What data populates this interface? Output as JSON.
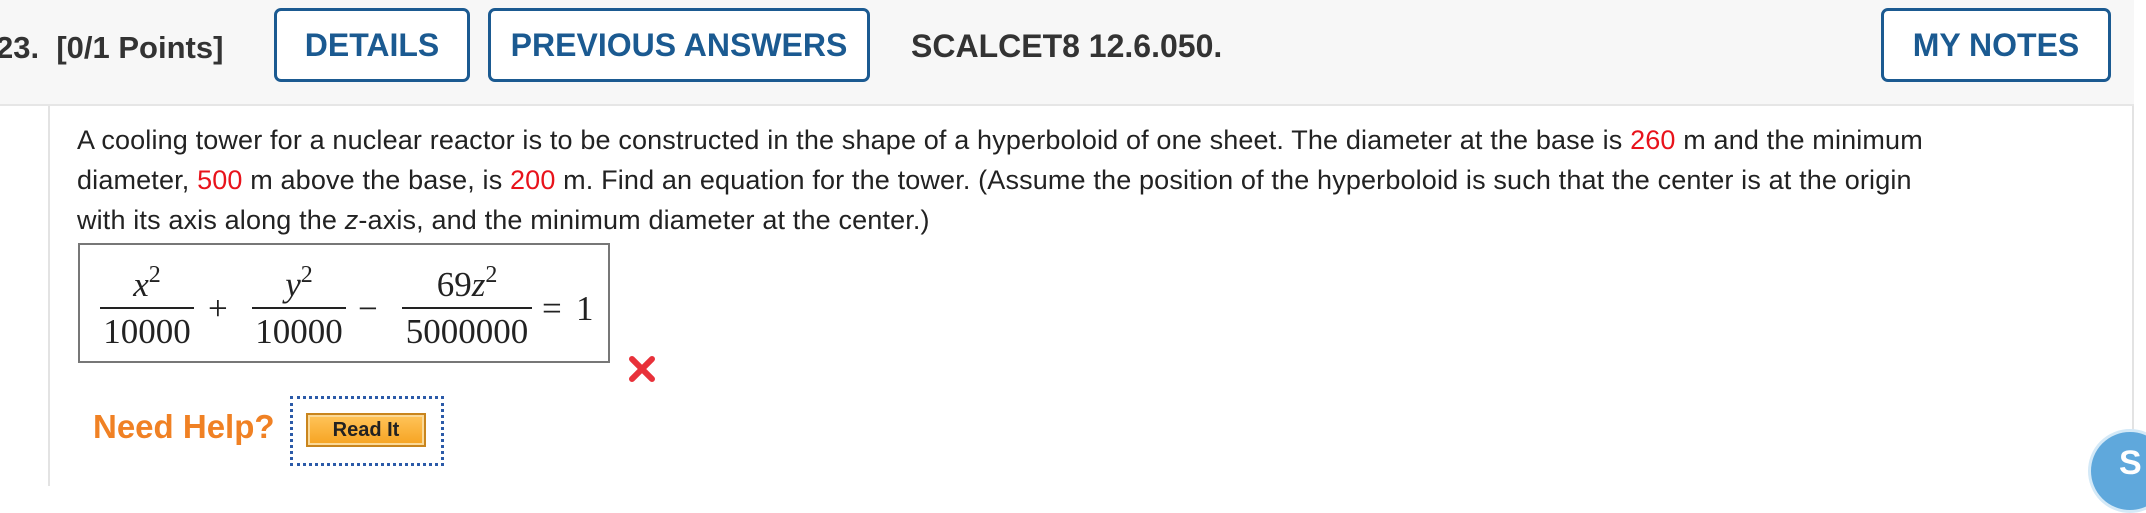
{
  "header": {
    "question_number": "23.",
    "points": "[0/1 Points]",
    "details_label": "DETAILS",
    "previous_answers_label": "PREVIOUS ANSWERS",
    "question_code": "SCALCET8 12.6.050.",
    "my_notes_label": "MY NOTES"
  },
  "problem": {
    "part1": "A cooling tower for a nuclear reactor is to be constructed in the shape of a hyperboloid of one sheet. The diameter at the base is ",
    "base_diameter": "260",
    "part2": " m and the minimum",
    "part3": "diameter, ",
    "height_above_base": "500",
    "part4": " m above the base, is ",
    "min_diameter": "200",
    "part5": " m. Find an equation for the tower. (Assume the position of the hyperboloid is such that the center is at the origin",
    "part6": "with its axis along the ",
    "axis_var": "z",
    "part7": "-axis, and the minimum diameter at the center.)"
  },
  "answer": {
    "term1_var": "x",
    "term1_exp": "2",
    "term1_den": "10000",
    "op1": "+",
    "term2_var": "y",
    "term2_exp": "2",
    "term2_den": "10000",
    "op2": "−",
    "term3_coef": "69",
    "term3_var": "z",
    "term3_exp": "2",
    "term3_den": "5000000",
    "equals": "=",
    "rhs": "1",
    "status": "incorrect",
    "status_icon": "x-mark-icon",
    "status_color": "#e8313a"
  },
  "help": {
    "label": "Need Help?",
    "read_it_label": "Read It"
  },
  "colors": {
    "accent": "#1b5a91",
    "given_value": "#e8131b",
    "help_label": "#f08124"
  }
}
